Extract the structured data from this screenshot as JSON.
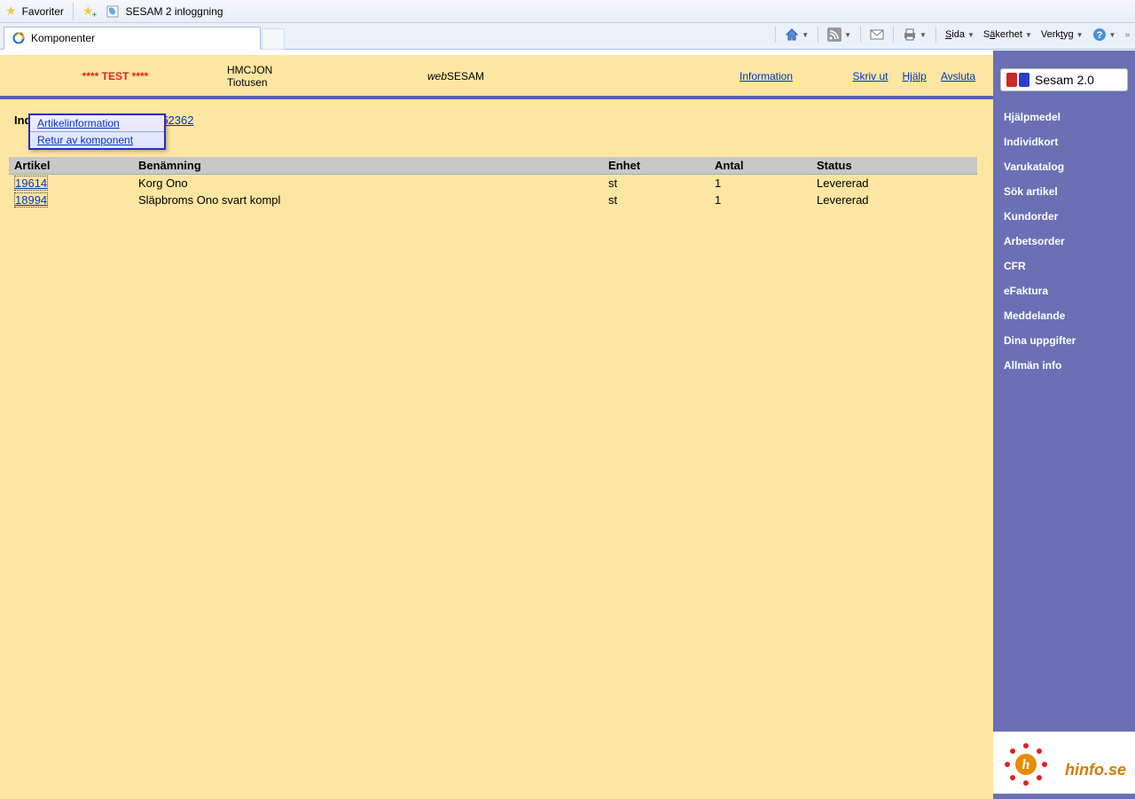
{
  "ie": {
    "favorites": "Favoriter",
    "bookmark": "SESAM 2 inloggning",
    "tab_title": "Komponenter",
    "cmd_sida": "Sida",
    "cmd_sakerhet": "Säkerhet",
    "cmd_verktyg": "Verktyg"
  },
  "header": {
    "test": "**** TEST ****",
    "user_line1": "HMCJON",
    "user_line2": "Tiotusen",
    "websesam_web": "web",
    "websesam_sesam": "SESAM",
    "info": "Information",
    "skriv": "Skriv ut",
    "hjalp": "Hjälp",
    "avsluta": "Avsluta"
  },
  "individ": {
    "label": "Individ",
    "value": "1052362"
  },
  "context_menu": {
    "item1": "Artikelinformation",
    "item2": "Retur av komponent"
  },
  "table": {
    "headers": {
      "artikel": "Artikel",
      "benamning": "Benämning",
      "enhet": "Enhet",
      "antal": "Antal",
      "status": "Status"
    },
    "rows": [
      {
        "artikel": "19614",
        "benamning": "Korg Ono",
        "enhet": "st",
        "antal": "1",
        "status": "Levererad"
      },
      {
        "artikel": "18994",
        "benamning": "Släpbroms Ono svart kompl",
        "enhet": "st",
        "antal": "1",
        "status": "Levererad"
      }
    ]
  },
  "sidebar": {
    "logo": "Sesam 2.0",
    "items": [
      "Hjälpmedel",
      "Individkort",
      "Varukatalog",
      "Sök artikel",
      "Kundorder",
      "Arbetsorder",
      "CFR",
      "eFaktura",
      "Meddelande",
      "Dina uppgifter",
      "Allmän info"
    ],
    "hinfo": "hinfo.se"
  }
}
